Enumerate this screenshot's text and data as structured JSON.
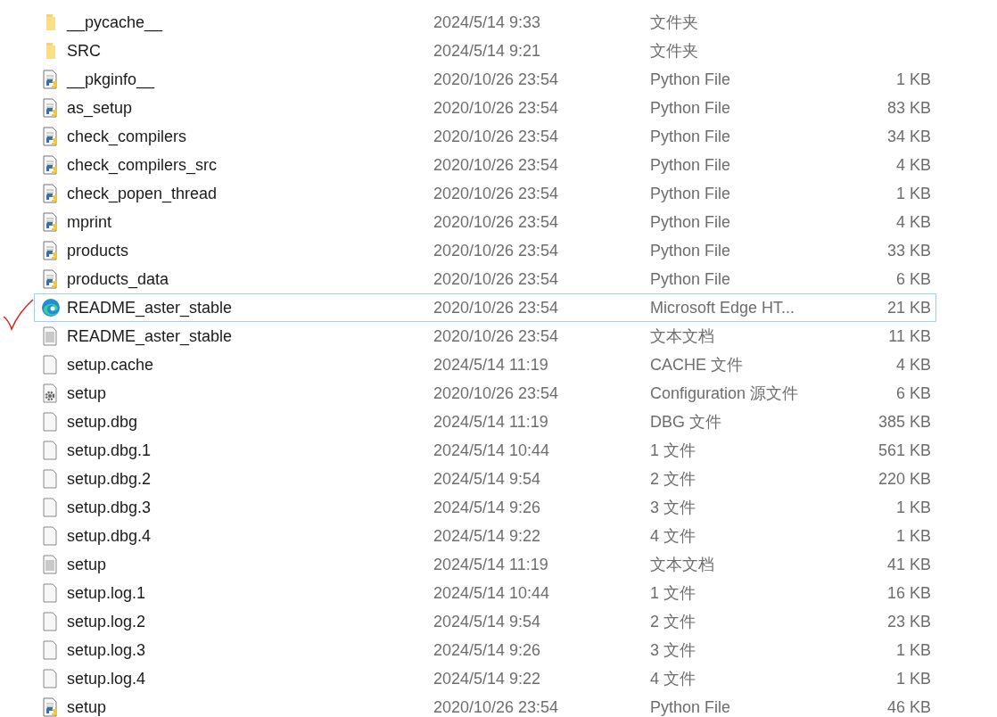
{
  "files": [
    {
      "name": "__pycache__",
      "kind": "folder",
      "date": "2024/5/14 9:33",
      "type": "文件夹",
      "selected": false,
      "marked": false
    },
    {
      "name": "SRC",
      "kind": "folder",
      "date": "2024/5/14 9:21",
      "type": "文件夹",
      "selected": false,
      "marked": false
    },
    {
      "name": "__pkginfo__",
      "kind": "python",
      "date": "2020/10/26 23:54",
      "type": "Python File",
      "size": "1 KB",
      "selected": false,
      "marked": false
    },
    {
      "name": "as_setup",
      "kind": "python",
      "date": "2020/10/26 23:54",
      "type": "Python File",
      "size": "83 KB",
      "selected": false,
      "marked": false
    },
    {
      "name": "check_compilers",
      "kind": "python",
      "date": "2020/10/26 23:54",
      "type": "Python File",
      "size": "34 KB",
      "selected": false,
      "marked": false
    },
    {
      "name": "check_compilers_src",
      "kind": "python",
      "date": "2020/10/26 23:54",
      "type": "Python File",
      "size": "4 KB",
      "selected": false,
      "marked": false
    },
    {
      "name": "check_popen_thread",
      "kind": "python",
      "date": "2020/10/26 23:54",
      "type": "Python File",
      "size": "1 KB",
      "selected": false,
      "marked": false
    },
    {
      "name": "mprint",
      "kind": "python",
      "date": "2020/10/26 23:54",
      "type": "Python File",
      "size": "4 KB",
      "selected": false,
      "marked": false
    },
    {
      "name": "products",
      "kind": "python",
      "date": "2020/10/26 23:54",
      "type": "Python File",
      "size": "33 KB",
      "selected": false,
      "marked": false
    },
    {
      "name": "products_data",
      "kind": "python",
      "date": "2020/10/26 23:54",
      "type": "Python File",
      "size": "6 KB",
      "selected": false,
      "marked": false
    },
    {
      "name": "README_aster_stable",
      "kind": "edge",
      "date": "2020/10/26 23:54",
      "type": "Microsoft Edge HT...",
      "size": "21 KB",
      "selected": true,
      "marked": true
    },
    {
      "name": "README_aster_stable",
      "kind": "text",
      "date": "2020/10/26 23:54",
      "type": "文本文档",
      "size": "11 KB",
      "selected": false,
      "marked": false
    },
    {
      "name": "setup.cache",
      "kind": "blank",
      "date": "2024/5/14 11:19",
      "type": "CACHE 文件",
      "size": "4 KB",
      "selected": false,
      "marked": false
    },
    {
      "name": "setup",
      "kind": "config",
      "date": "2020/10/26 23:54",
      "type": "Configuration 源文件",
      "size": "6 KB",
      "selected": false,
      "marked": false
    },
    {
      "name": "setup.dbg",
      "kind": "blank",
      "date": "2024/5/14 11:19",
      "type": "DBG 文件",
      "size": "385 KB",
      "selected": false,
      "marked": false
    },
    {
      "name": "setup.dbg.1",
      "kind": "blank",
      "date": "2024/5/14 10:44",
      "type": "1 文件",
      "size": "561 KB",
      "selected": false,
      "marked": false
    },
    {
      "name": "setup.dbg.2",
      "kind": "blank",
      "date": "2024/5/14 9:54",
      "type": "2 文件",
      "size": "220 KB",
      "selected": false,
      "marked": false
    },
    {
      "name": "setup.dbg.3",
      "kind": "blank",
      "date": "2024/5/14 9:26",
      "type": "3 文件",
      "size": "1 KB",
      "selected": false,
      "marked": false
    },
    {
      "name": "setup.dbg.4",
      "kind": "blank",
      "date": "2024/5/14 9:22",
      "type": "4 文件",
      "size": "1 KB",
      "selected": false,
      "marked": false
    },
    {
      "name": "setup",
      "kind": "text",
      "date": "2024/5/14 11:19",
      "type": "文本文档",
      "size": "41 KB",
      "selected": false,
      "marked": false
    },
    {
      "name": "setup.log.1",
      "kind": "blank",
      "date": "2024/5/14 10:44",
      "type": "1 文件",
      "size": "16 KB",
      "selected": false,
      "marked": false
    },
    {
      "name": "setup.log.2",
      "kind": "blank",
      "date": "2024/5/14 9:54",
      "type": "2 文件",
      "size": "23 KB",
      "selected": false,
      "marked": false
    },
    {
      "name": "setup.log.3",
      "kind": "blank",
      "date": "2024/5/14 9:26",
      "type": "3 文件",
      "size": "1 KB",
      "selected": false,
      "marked": false
    },
    {
      "name": "setup.log.4",
      "kind": "blank",
      "date": "2024/5/14 9:22",
      "type": "4 文件",
      "size": "1 KB",
      "selected": false,
      "marked": false
    },
    {
      "name": "setup",
      "kind": "python",
      "date": "2020/10/26 23:54",
      "type": "Python File",
      "size": "46 KB",
      "selected": false,
      "marked": false
    }
  ]
}
